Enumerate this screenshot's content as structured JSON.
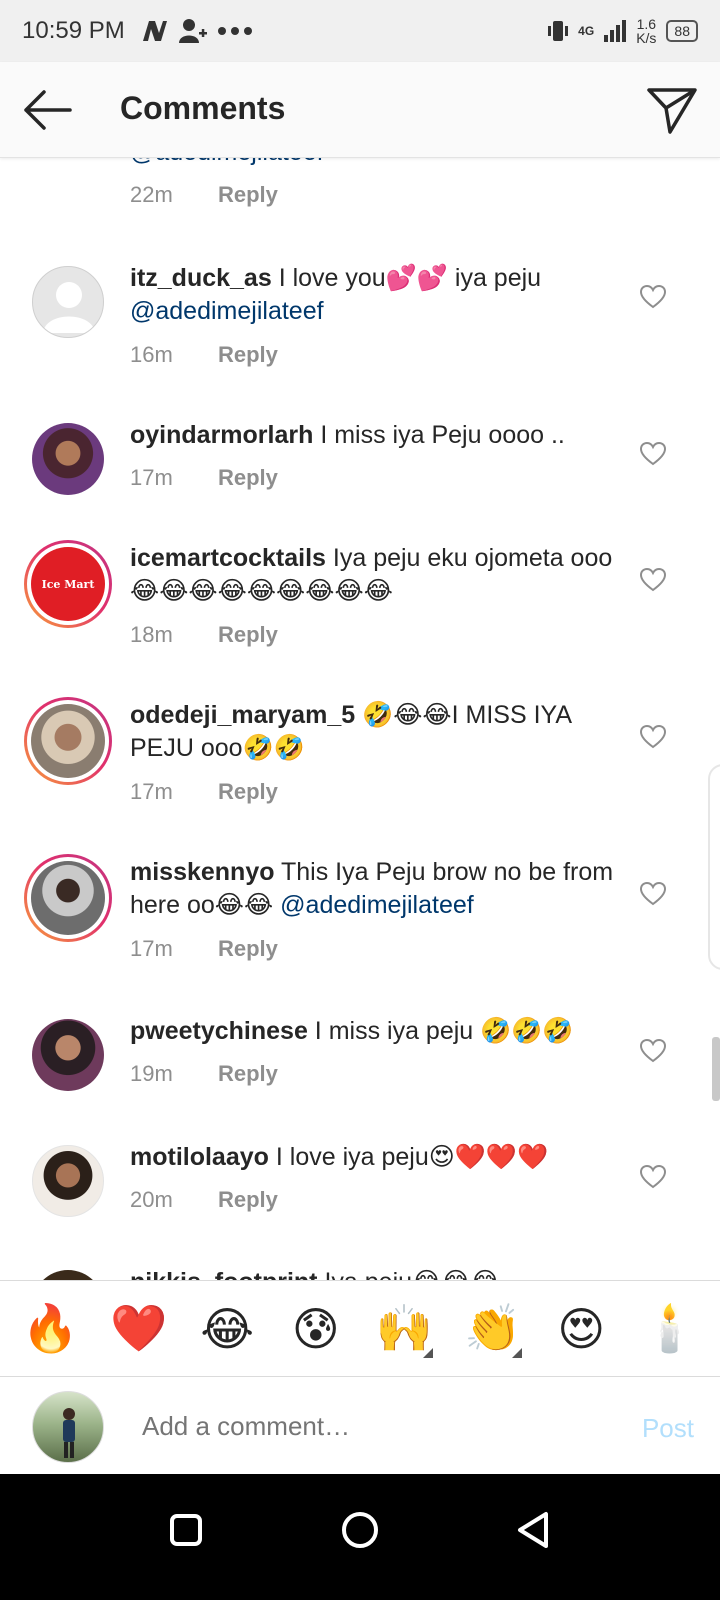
{
  "status": {
    "time": "10:59 PM",
    "net_left": "4G",
    "speed_top": "1.6",
    "speed_bottom": "K/s",
    "battery": "88"
  },
  "header": {
    "title": "Comments"
  },
  "partial_top": {
    "mention": "@adedimejilateef",
    "time": "22m",
    "reply": "Reply"
  },
  "comments": [
    {
      "user": "itz_duck_as",
      "text": " I love you💕💕 iya peju ",
      "mention": "@adedimejilateef",
      "time": "16m",
      "reply": "Reply"
    },
    {
      "user": "oyindarmorlarh",
      "text": " I miss iya Peju oooo ..",
      "mention": "",
      "time": "17m",
      "reply": "Reply"
    },
    {
      "user": "icemartcocktails",
      "text": " Iya peju eku ojometa ooo😂😂😂😂😂😂😂😂😂",
      "mention": "",
      "time": "18m",
      "reply": "Reply",
      "badge": "Ice Mart"
    },
    {
      "user": "odedeji_maryam_5",
      "text": " 🤣😂😂I MISS IYA PEJU ooo🤣🤣",
      "mention": "",
      "time": "17m",
      "reply": "Reply"
    },
    {
      "user": "misskennyo",
      "text": " This Iya Peju brow no be from here oo😂😂 ",
      "mention": "@adedimejilateef",
      "time": "17m",
      "reply": "Reply"
    },
    {
      "user": "pweetychinese",
      "text": " I miss iya peju 🤣🤣🤣",
      "mention": "",
      "time": "19m",
      "reply": "Reply"
    },
    {
      "user": "motilolaayo",
      "text": " I love iya peju😍❤️❤️❤️",
      "mention": "",
      "time": "20m",
      "reply": "Reply"
    },
    {
      "user": "nikkis_footprint",
      "text": " Iya peju😂😂😂",
      "mention": "",
      "time": "",
      "reply": ""
    }
  ],
  "emojis": [
    "🔥",
    "❤️",
    "😂",
    "😰",
    "🙌",
    "👏",
    "😍",
    "🕯️"
  ],
  "input": {
    "placeholder": "Add a comment…",
    "post": "Post"
  },
  "colors": {
    "link": "#00376b",
    "muted": "#8e8e8e",
    "post_disabled": "#b2dffc"
  }
}
